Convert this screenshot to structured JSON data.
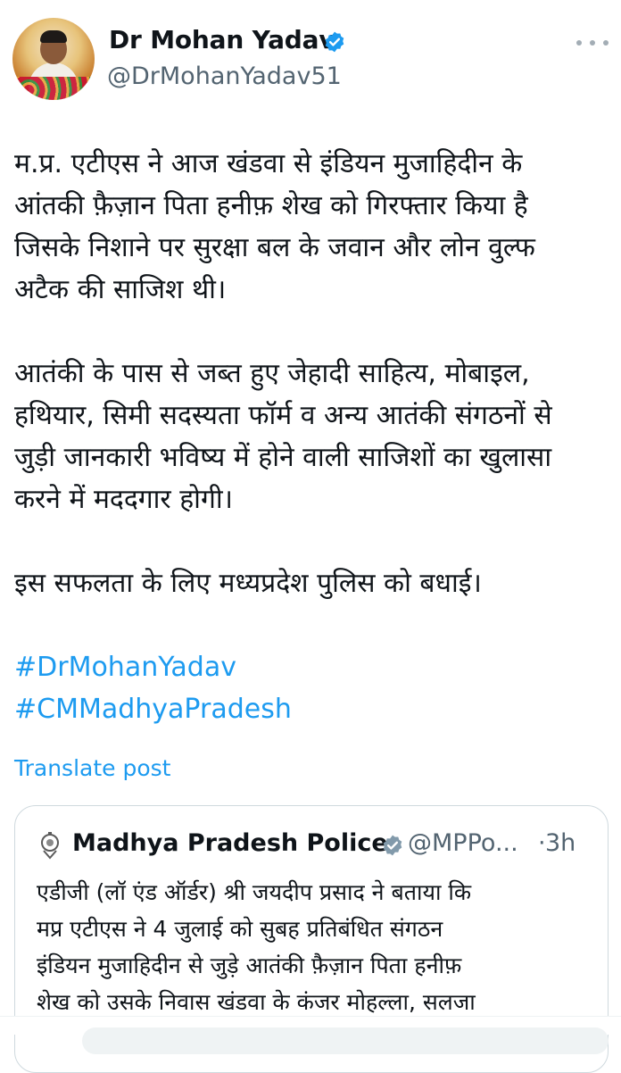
{
  "author": {
    "name": "Dr Mohan Yadav",
    "handle": "@DrMohanYadav51",
    "verified": true
  },
  "tweet": {
    "paragraph1": [
      "म.प्र. एटीएस ने आज खंडवा से इंडियन मुजाहिदीन के",
      "आंतकी फ़ैज़ान पिता हनीफ़ शेख को गिरफ्तार किया है",
      "जिसके निशाने पर सुरक्षा बल के जवान और लोन वुल्फ",
      "अटैक की साजिश थी।"
    ],
    "paragraph2": [
      "आतंकी के पास से जब्त हुए जेहादी साहित्य, मोबाइल,",
      "हथियार, सिमी सदस्यता फॉर्म व अन्य आतंकी संगठनों से",
      "जुड़ी जानकारी भविष्य में होने वाली साजिशों का खुलासा",
      "करने में मददगार होगी।"
    ],
    "paragraph3": "इस सफलता के लिए मध्यप्रदेश पुलिस को बधाई।",
    "hashtags": [
      "#DrMohanYadav",
      "#CMMadhyaPradesh"
    ]
  },
  "translate_label": "Translate post",
  "quote": {
    "name": "Madhya Pradesh Police",
    "handle": "@MPPo...",
    "separator": "·",
    "time": "3h",
    "lines": [
      "एडीजी (लॉ एंड ऑर्डर) श्री जयदीप प्रसाद ने बताया कि",
      "मप्र एटीएस ने 4 जुलाई को सुबह प्रतिबंधित संगठन",
      "इंडियन मुजाहिदीन से जुड़े आतंकी फ़ैज़ान पिता हनीफ़",
      "शेख को उसके निवास खंडवा के कंजर मोहल्ला, सलजा"
    ]
  },
  "icons": {
    "verified": "verified-badge-icon",
    "more": "more-options-icon",
    "emblem": "police-emblem-icon"
  },
  "colors": {
    "accent": "#1d9bf0",
    "secondary_text": "#536471",
    "border": "#cfd9de"
  }
}
